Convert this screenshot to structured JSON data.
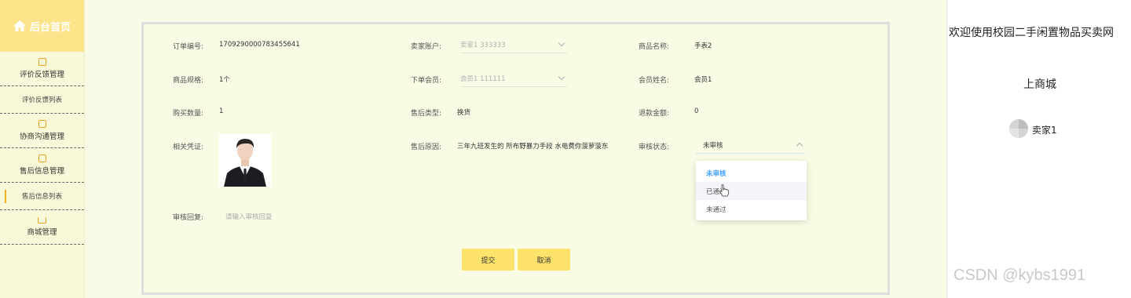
{
  "sidebar": {
    "home_label": "后台首页",
    "menus": [
      {
        "label": "评价反馈管理",
        "icon": "edit-icon"
      },
      {
        "label": "评价反馈列表",
        "sub": true
      },
      {
        "label": "协商沟通管理",
        "icon": "edit-icon"
      },
      {
        "label": "售后信息管理",
        "icon": "edit-icon"
      },
      {
        "label": "售后信息列表",
        "sub": true,
        "active": true
      },
      {
        "label": "商城管理",
        "icon": "cart-icon"
      }
    ]
  },
  "form": {
    "order_no": {
      "label": "订单编号:",
      "value": "1709290000783455641"
    },
    "seller_account": {
      "label": "卖家账户:",
      "value": "卖家1 333333"
    },
    "product_name": {
      "label": "商品名称:",
      "value": "手表2"
    },
    "product_spec": {
      "label": "商品规格:",
      "value": "1个"
    },
    "order_member": {
      "label": "下单会员:",
      "value": "会员1 111111"
    },
    "member_name": {
      "label": "会员姓名:",
      "value": "会员1"
    },
    "purchase_qty": {
      "label": "购买数量:",
      "value": "1"
    },
    "after_sale_type": {
      "label": "售后类型:",
      "value": "换货"
    },
    "refund_amount": {
      "label": "退款金额:",
      "value": "0"
    },
    "evidence": {
      "label": "相关凭证:"
    },
    "reason": {
      "label": "售后原因:",
      "value": "三年九班发生的 所布野暴力手段 水电费你菠萝菠东"
    },
    "review_status": {
      "label": "审核状态:",
      "value": "未审核",
      "options": [
        "未审核",
        "已通过",
        "未通过"
      ]
    },
    "review_reply": {
      "label": "审核回复:",
      "placeholder": "请输入审核回复"
    }
  },
  "buttons": {
    "submit": "提交",
    "cancel": "取消"
  },
  "right": {
    "welcome": "欢迎使用校园二手闲置物品买卖网",
    "mall_link": "上商城",
    "username": "卖家1"
  },
  "watermark": "CSDN @kybs1991",
  "colors": {
    "accent": "#fde36b",
    "selected": "#409eff"
  }
}
